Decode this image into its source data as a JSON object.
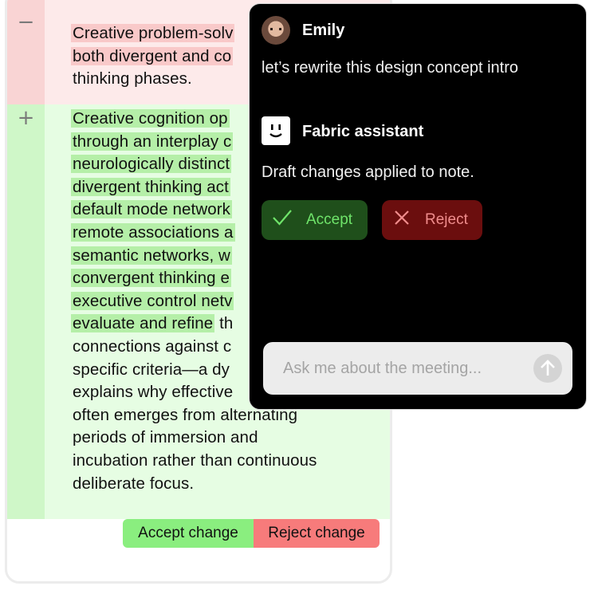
{
  "note": {
    "removed_sign": "−",
    "added_sign": "+",
    "removed_lines": [
      {
        "text": "Creative problem-solv",
        "highlight": true
      },
      {
        "text": "both divergent and co",
        "highlight": true
      },
      {
        "text": "thinking phases.",
        "highlight": false
      }
    ],
    "added_lines": [
      {
        "text": "Creative cognition op",
        "highlight": true
      },
      {
        "text": "through an interplay c",
        "highlight": true
      },
      {
        "text": "neurologically distinct",
        "highlight": true
      },
      {
        "text": "divergent thinking act",
        "highlight": true
      },
      {
        "text": "default mode network",
        "highlight": true
      },
      {
        "text": "remote associations a",
        "highlight": true
      },
      {
        "text": "semantic networks, w",
        "highlight": true
      },
      {
        "text": "convergent thinking e",
        "highlight": true
      },
      {
        "text": "executive control netv",
        "highlight": true
      },
      {
        "text": "evaluate and refine",
        "tail": " th",
        "highlight": true
      },
      {
        "text": "connections against c",
        "highlight": false
      },
      {
        "text": "specific criteria—a dy",
        "highlight": false
      },
      {
        "text": "explains why effective",
        "highlight": false
      },
      {
        "text": "often emerges from alternating",
        "highlight": false
      },
      {
        "text": "periods of immersion and",
        "highlight": false
      },
      {
        "text": "incubation rather than continuous",
        "highlight": false
      },
      {
        "text": "deliberate focus.",
        "highlight": false
      }
    ],
    "accept_change_label": "Accept change",
    "reject_change_label": "Reject change"
  },
  "chat": {
    "user": {
      "name": "Emily",
      "message": "let’s rewrite this design concept intro"
    },
    "assistant": {
      "name": "Fabric assistant",
      "message": "Draft changes applied to note.",
      "accept_label": "Accept",
      "reject_label": "Reject"
    },
    "input": {
      "placeholder": "Ask me about the meeting...",
      "value": ""
    }
  },
  "colors": {
    "removed_bg": "#fdeaea",
    "added_bg": "#e6fde3",
    "accept_green": "#8aee7f",
    "reject_red": "#f77b7b",
    "chat_bg": "#000000"
  }
}
